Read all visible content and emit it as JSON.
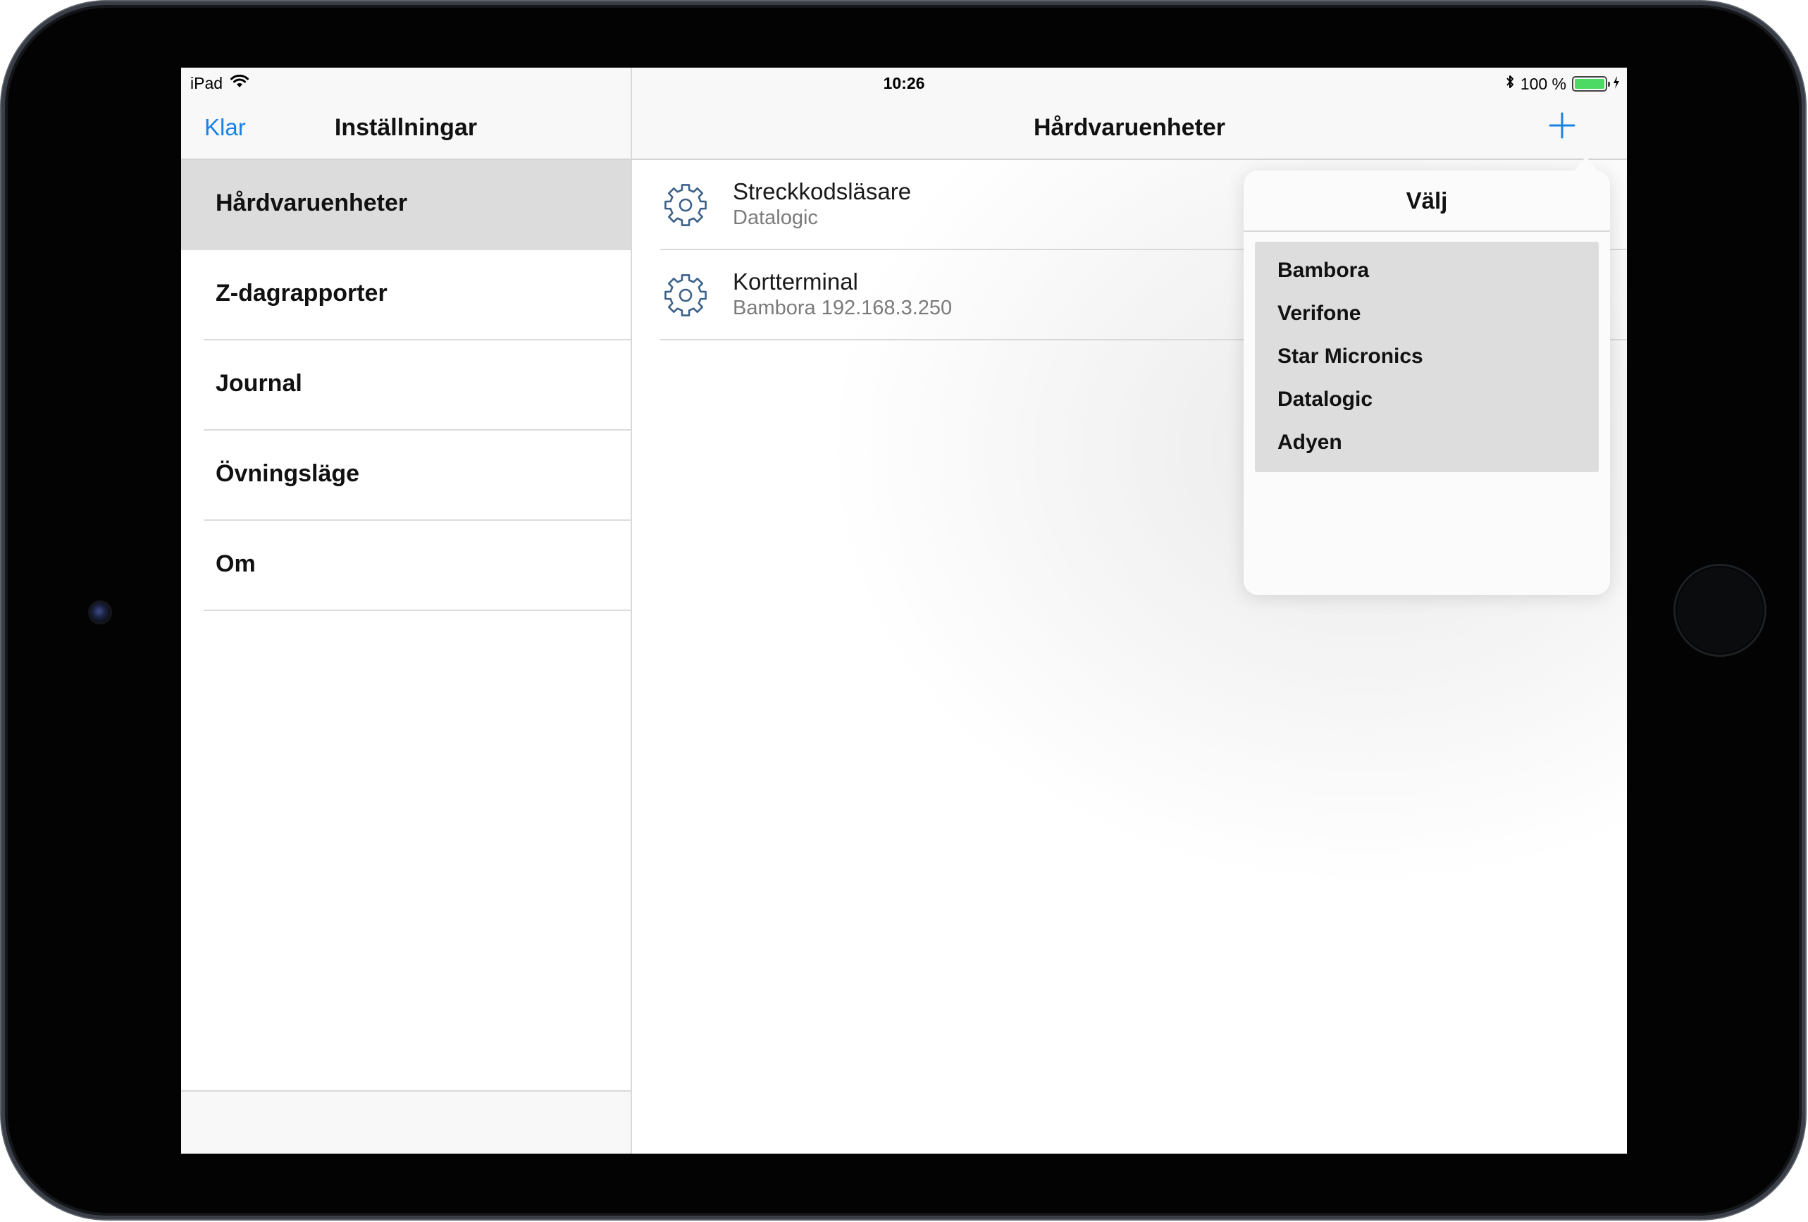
{
  "status_bar": {
    "device": "iPad",
    "time": "10:26",
    "battery_text": "100 %",
    "battery_level": 1.0,
    "battery_color": "#4cd964"
  },
  "master": {
    "back_label": "Klar",
    "title": "Inställningar",
    "items": [
      {
        "label": "Hårdvaruenheter",
        "selected": true
      },
      {
        "label": "Z-dagrapporter",
        "selected": false
      },
      {
        "label": "Journal",
        "selected": false
      },
      {
        "label": "Övningsläge",
        "selected": false
      },
      {
        "label": "Om",
        "selected": false
      }
    ]
  },
  "detail": {
    "title": "Hårdvaruenheter",
    "add_icon": "plus-icon",
    "devices": [
      {
        "name": "Streckkodsläsare",
        "detail": "Datalogic",
        "icon": "gear-icon"
      },
      {
        "name": "Kortterminal",
        "detail": "Bambora 192.168.3.250",
        "icon": "gear-icon"
      }
    ]
  },
  "popover": {
    "title": "Välj",
    "options": [
      "Bambora",
      "Verifone",
      "Star Micronics",
      "Datalogic",
      "Adyen"
    ]
  },
  "colors": {
    "accent": "#1a82e7",
    "selected_row": "#dcdcdc",
    "option_bg": "#dddddd"
  }
}
